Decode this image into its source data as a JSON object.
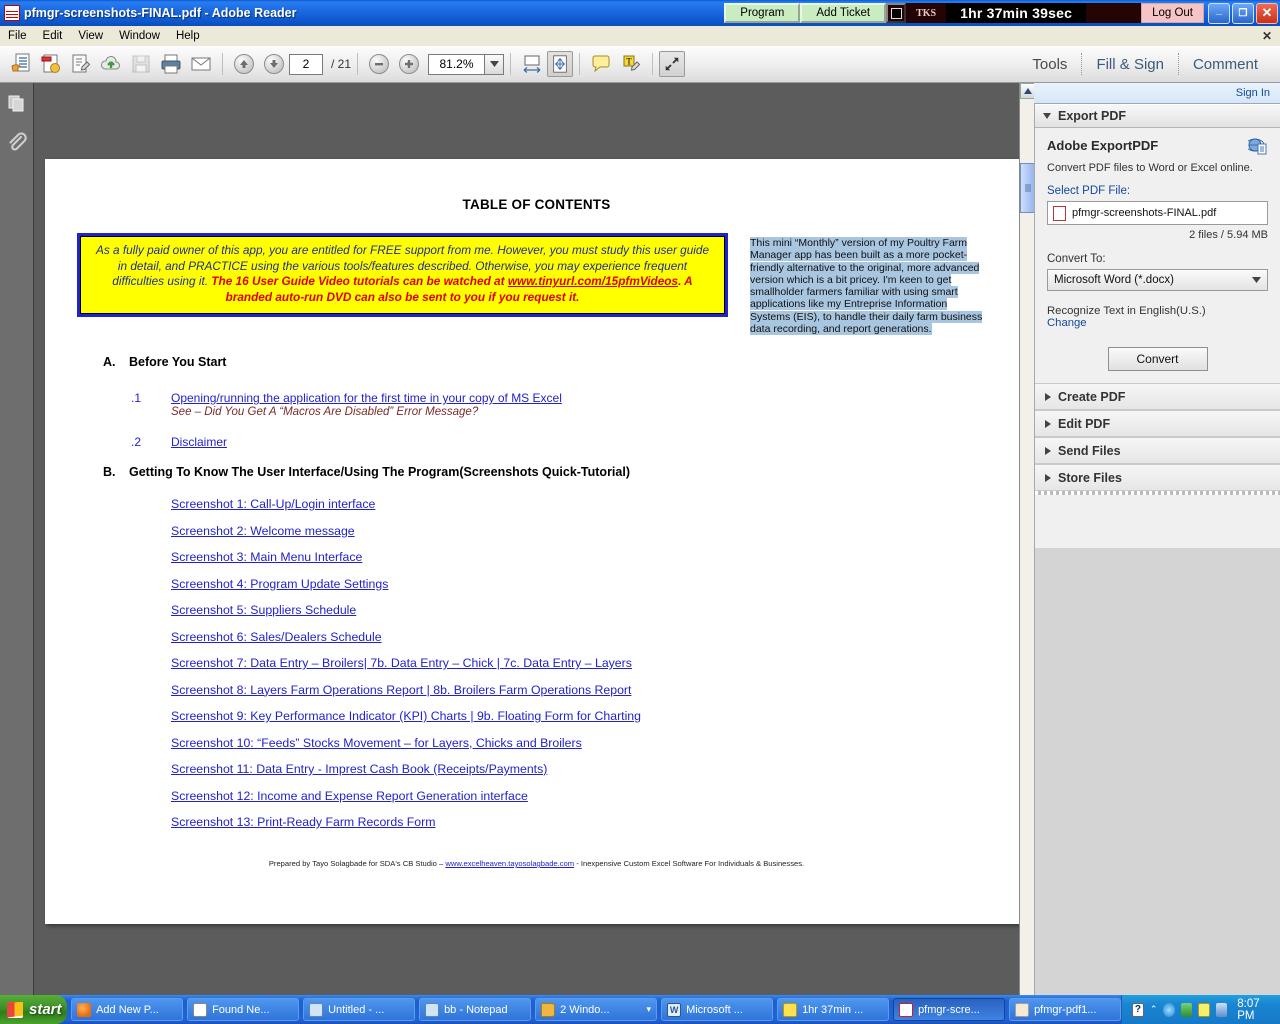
{
  "window": {
    "title": "pfmgr-screenshots-FINAL.pdf - Adobe Reader",
    "app_icon": "pdf-icon",
    "minimize": "_",
    "maximize": "❐",
    "close": "✕"
  },
  "timer_widget": {
    "program_button": "Program",
    "add_ticket_button": "Add Ticket",
    "checkbox_name": "timer-checkbox",
    "tks_label": "TKS",
    "elapsed": "1hr 37min 39sec",
    "logout_button": "Log Out"
  },
  "menubar": {
    "items": [
      "File",
      "Edit",
      "View",
      "Window",
      "Help"
    ],
    "close_doc": "✕"
  },
  "toolbar": {
    "icons": [
      "open-file-icon",
      "create-pdf-icon",
      "edit-pdf-icon",
      "upload-cloud-icon",
      "save-icon",
      "print-icon",
      "email-icon"
    ],
    "prev_page_icon": "arrow-up-icon",
    "next_page_icon": "arrow-down-icon",
    "page_number": "2",
    "page_total": "/ 21",
    "zoom_out_icon": "minus-icon",
    "zoom_in_icon": "plus-icon",
    "zoom_value": "81.2%",
    "zoom_dropdown_icon": "chevron-down-icon",
    "fit_width_icon": "fit-width-icon",
    "fit_page_icon": "fit-page-icon",
    "comment_icon": "sticky-note-icon",
    "highlight_icon": "highlight-text-icon",
    "fullscreen_icon": "expand-arrows-icon",
    "tools_label": "Tools",
    "fill_sign_label": "Fill & Sign",
    "comment_label": "Comment"
  },
  "leftnav": {
    "thumbnails_icon": "page-thumbnails-icon",
    "attachments_icon": "paperclip-icon"
  },
  "document": {
    "title": "TABLE OF CONTENTS",
    "notice": {
      "line1": "As a fully paid owner of this app, you are entitled for FREE support from me. However, you must study this",
      "line2": "user guide in detail, and PRACTICE using the various tools/features described. Otherwise, you may",
      "line3": "experience frequent difficulties using it.",
      "red1": " The 16 User Guide Video tutorials can be watched at",
      "link": "www.tinyurl.com/15pfmVideos",
      "red2": ". A branded auto-run DVD can also be sent to you if you request it."
    },
    "sticky_note": "This mini “Monthly” version of my Poultry Farm Manager app has been built as a more pocket-friendly alternative to the original, more advanced version which is a bit pricey. I'm keen to get smallholder farmers familiar with using smart applications like my Entreprise Information Systems (EIS), to handle their daily farm business data recording, and report generations.",
    "section_a": {
      "label": "A.",
      "title": "Before You Start",
      "items": [
        {
          "num": ".1",
          "link": "Opening/running the application for the first time in your copy of MS Excel",
          "note": "See – Did You Get A “Macros Are Disabled” Error Message?"
        },
        {
          "num": ".2",
          "link": "Disclaimer",
          "note": ""
        }
      ]
    },
    "section_b": {
      "label": "B.",
      "title": "Getting To Know The User Interface/Using The Program(Screenshots Quick-Tutorial)",
      "links": [
        "Screenshot 1:  Call-Up/Login interface",
        "Screenshot 2: Welcome message",
        "Screenshot 3: Main Menu Interface",
        "Screenshot 4: Program Update Settings",
        "Screenshot 5: Suppliers Schedule",
        "Screenshot 6: Sales/Dealers Schedule",
        "Screenshot 7: Data Entry – Broilers| 7b. Data Entry – Chick | 7c. Data Entry – Layers",
        "Screenshot 8: Layers Farm Operations Report | 8b. Broilers Farm Operations Report",
        "Screenshot 9: Key Performance Indicator (KPI) Charts | 9b. Floating Form for Charting",
        "Screenshot 10: “Feeds” Stocks Movement – for Layers, Chicks and Broilers",
        "Screenshot 11: Data Entry - Imprest Cash Book (Receipts/Payments)",
        "Screenshot 12: Income and Expense Report Generation  interface",
        "Screenshot 13: Print-Ready Farm Records Form"
      ]
    },
    "footer": {
      "before": "Prepared by Tayo Solagbade for SDA's CB Studio – ",
      "link": "www.excelheaven.tayosolagbade.com",
      "after": " - Inexpensive Custom Excel Software For Individuals & Businesses."
    }
  },
  "right_panel": {
    "sign_in": "Sign In",
    "export_header": "Export PDF",
    "heading": "Adobe ExportPDF",
    "description": "Convert PDF files to Word or Excel online.",
    "select_label": "Select PDF File:",
    "selected_file": "pfmgr-screenshots-FINAL.pdf",
    "files_info": "2 files / 5.94 MB",
    "convert_label": "Convert To:",
    "convert_value": "Microsoft Word (*.docx)",
    "ocr_text": "Recognize Text in English(U.S.)",
    "change_link": "Change",
    "convert_button": "Convert",
    "sections": [
      "Create PDF",
      "Edit PDF",
      "Send Files",
      "Store Files"
    ]
  },
  "taskbar": {
    "start": "start",
    "tasks": [
      {
        "label": "Add New P...",
        "icon": "firefox-icon",
        "color": "#e8690b",
        "active": false
      },
      {
        "label": "Found Ne...",
        "icon": "window-icon",
        "color": "#ffffff",
        "active": false
      },
      {
        "label": "Untitled - ...",
        "icon": "notepad-icon",
        "color": "#bcd7f0",
        "active": false
      },
      {
        "label": "bb - Notepad",
        "icon": "notepad-icon",
        "color": "#bcd7f0",
        "active": false
      },
      {
        "label": "2 Windo...",
        "icon": "folder-icon",
        "color": "#f5c451",
        "active": false
      },
      {
        "label": "Microsoft ...",
        "icon": "word-icon",
        "color": "#dbe9fa",
        "active": false
      },
      {
        "label": "1hr 37min ...",
        "icon": "clock-icon",
        "color": "#ffe14d",
        "active": false
      },
      {
        "label": "pfmgr-scre...",
        "icon": "pdf-icon",
        "color": "#d33",
        "active": true
      },
      {
        "label": "pfmgr-pdf1...",
        "icon": "pdf-tool-icon",
        "color": "#f0e9d8",
        "active": false
      }
    ],
    "group_chevron": "▾",
    "tray_icons": [
      "help-icon",
      "show-hidden-icon",
      "network-icon",
      "volume-icon",
      "update-icon"
    ],
    "clock": "8:07 PM"
  }
}
